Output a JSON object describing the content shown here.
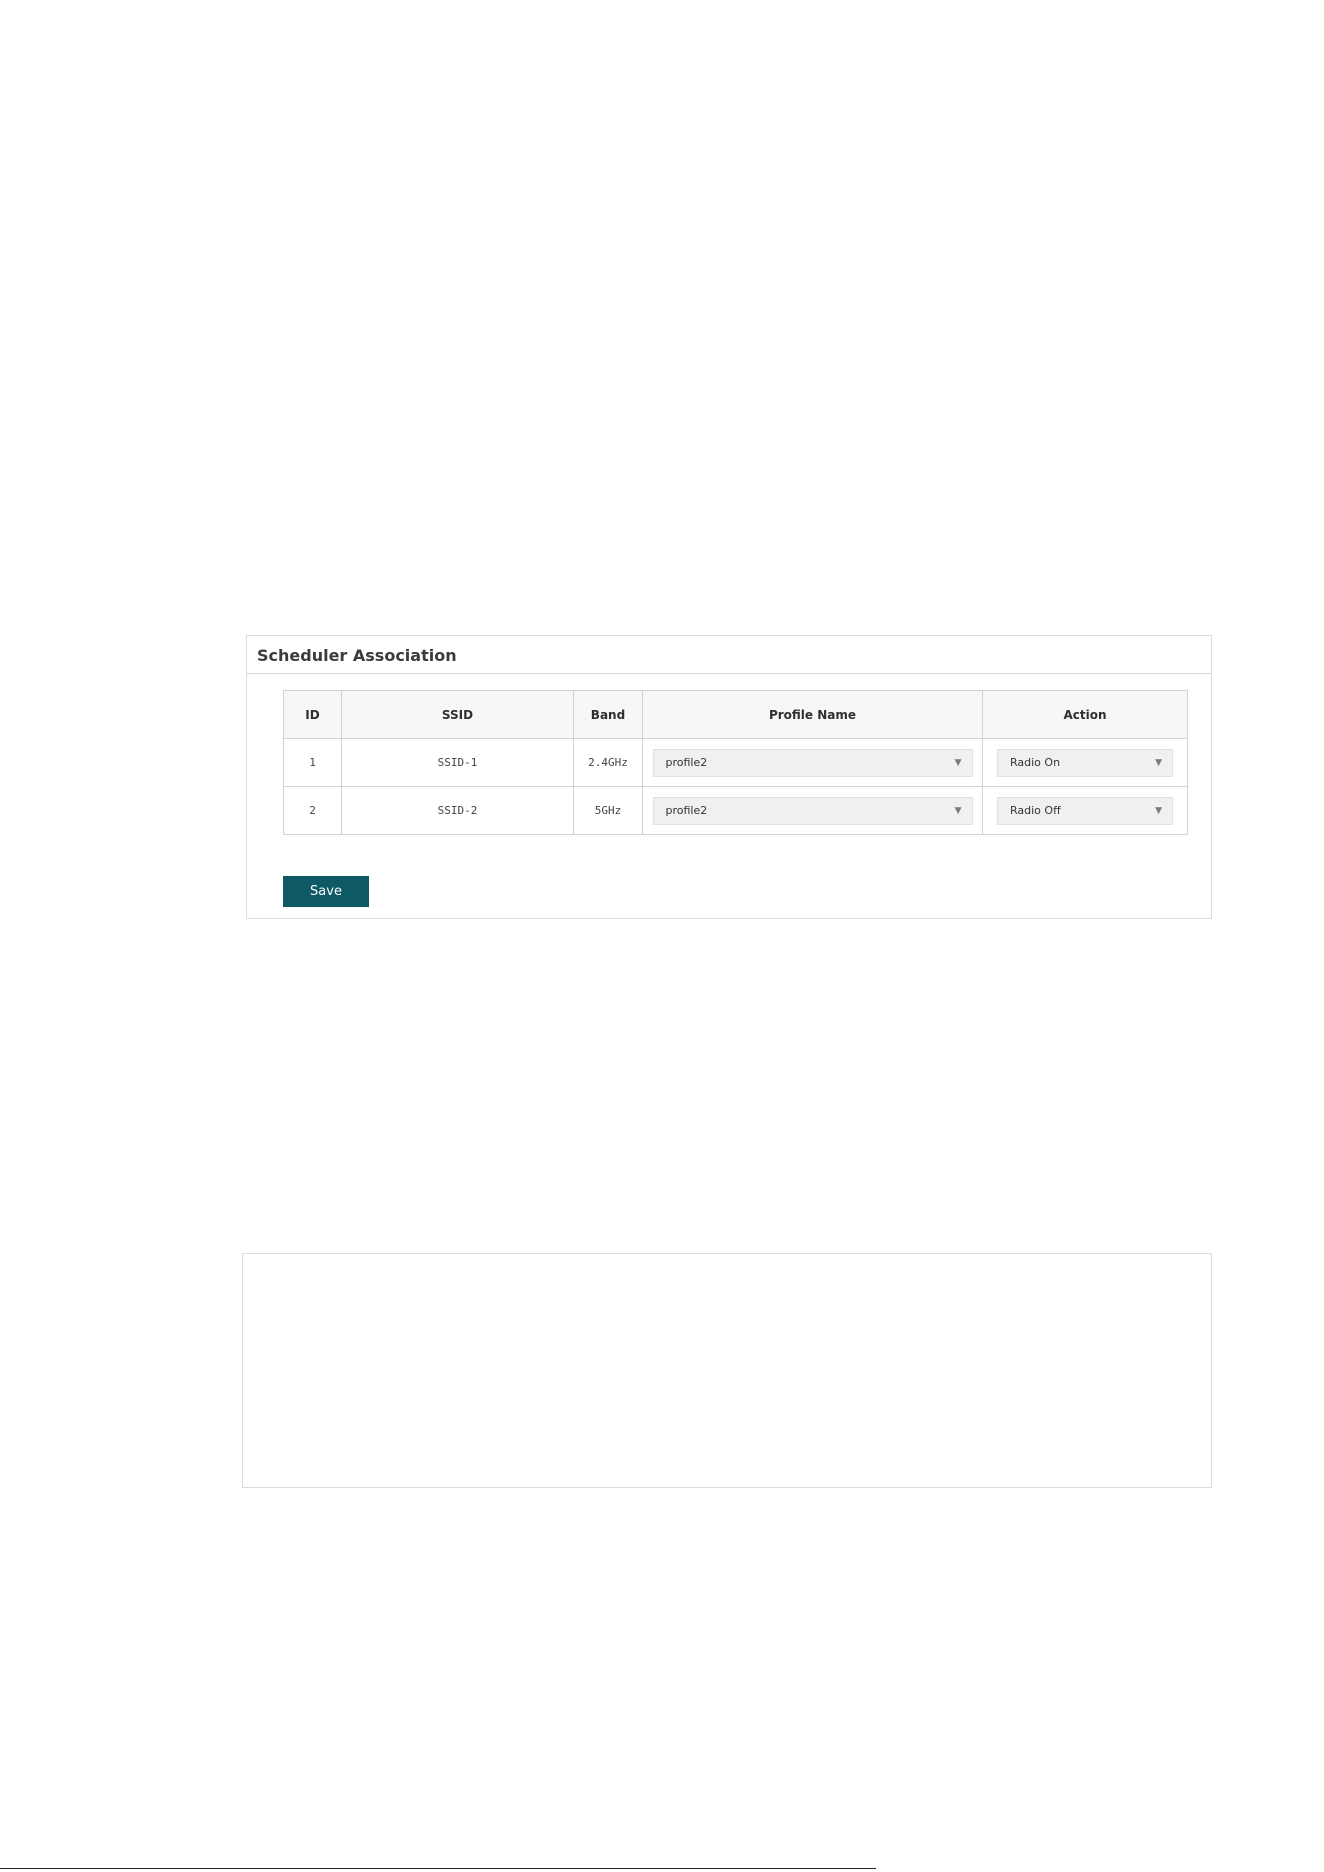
{
  "panel": {
    "title": "Scheduler Association",
    "save_label": "Save"
  },
  "table": {
    "headers": [
      "ID",
      "SSID",
      "Band",
      "Profile Name",
      "Action"
    ],
    "rows": [
      {
        "id": "1",
        "ssid": "SSID-1",
        "band": "2.4GHz",
        "profile": "profile2",
        "action": "Radio On"
      },
      {
        "id": "2",
        "ssid": "SSID-2",
        "band": "5GHz",
        "profile": "profile2",
        "action": "Radio Off"
      }
    ]
  },
  "icons": {
    "dropdown": "chevron-down-icon",
    "dropdown_glyph": "▼"
  },
  "colors": {
    "save_button": "#0d5965",
    "header_bg": "#f7f7f7",
    "select_bg": "#f0f0f0",
    "border": "#d2d2d2"
  }
}
